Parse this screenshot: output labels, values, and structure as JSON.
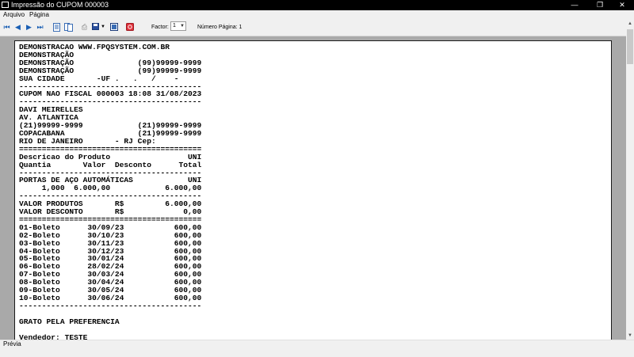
{
  "window": {
    "title": "Impressão do CUPOM 000003",
    "minimize": "—",
    "maximize": "❐",
    "close": "✕"
  },
  "menu": {
    "items": [
      "Arquivo",
      "Página"
    ]
  },
  "toolbar": {
    "icons": [
      "first-page-icon",
      "previous-page-icon",
      "next-page-icon",
      "last-page-icon",
      "single-page-icon",
      "two-pages-icon",
      "print-icon",
      "save-icon",
      "dropdown-arrow-icon",
      "export-icon",
      "close-preview-icon"
    ],
    "factor_label": "Factor:",
    "factor_value": "1",
    "page_number_label": "Número Página: 1"
  },
  "receipt": {
    "lines": [
      "DEMONSTRACAO WWW.FPQSYSTEM.COM.BR",
      "DEMONSTRAÇÃO",
      "DEMONSTRAÇÃO              (99)99999-9999",
      "DEMONSTRAÇÃO              (99)99999-9999",
      "SUA CIDADE       -UF .   .   /    -",
      "----------------------------------------",
      "CUPOM NAO FISCAL 000003 18:08 31/08/2023",
      "----------------------------------------",
      "DAVI MEIRELLES",
      "AV. ATLANTICA",
      "(21)99999-9999            (21)99999-9999",
      "COPACABANA                (21)99999-9999",
      "RIO DE JANEIRO       - RJ Cep:",
      "========================================",
      "Descricao do Produto                 UNI",
      "Quantia       Valor  Desconto      Total",
      "----------------------------------------",
      "PORTAS DE AÇO AUTOMÁTICAS            UNI",
      "     1,000  6.000,00            6.000,00",
      "----------------------------------------",
      "VALOR PRODUTOS       R$         6.000,00",
      "VALOR DESCONTO       R$             0,00",
      "========================================",
      "01-Boleto      30/09/23           600,00",
      "02-Boleto      30/10/23           600,00",
      "03-Boleto      30/11/23           600,00",
      "04-Boleto      30/12/23           600,00",
      "05-Boleto      30/01/24           600,00",
      "06-Boleto      28/02/24           600,00",
      "07-Boleto      30/03/24           600,00",
      "08-Boleto      30/04/24           600,00",
      "09-Boleto      30/05/24           600,00",
      "10-Boleto      30/06/24           600,00",
      "----------------------------------------",
      "",
      "GRATO PELA PREFERENCIA",
      "",
      "Vendedor: TESTE"
    ]
  },
  "status": {
    "label": "Prévia"
  }
}
